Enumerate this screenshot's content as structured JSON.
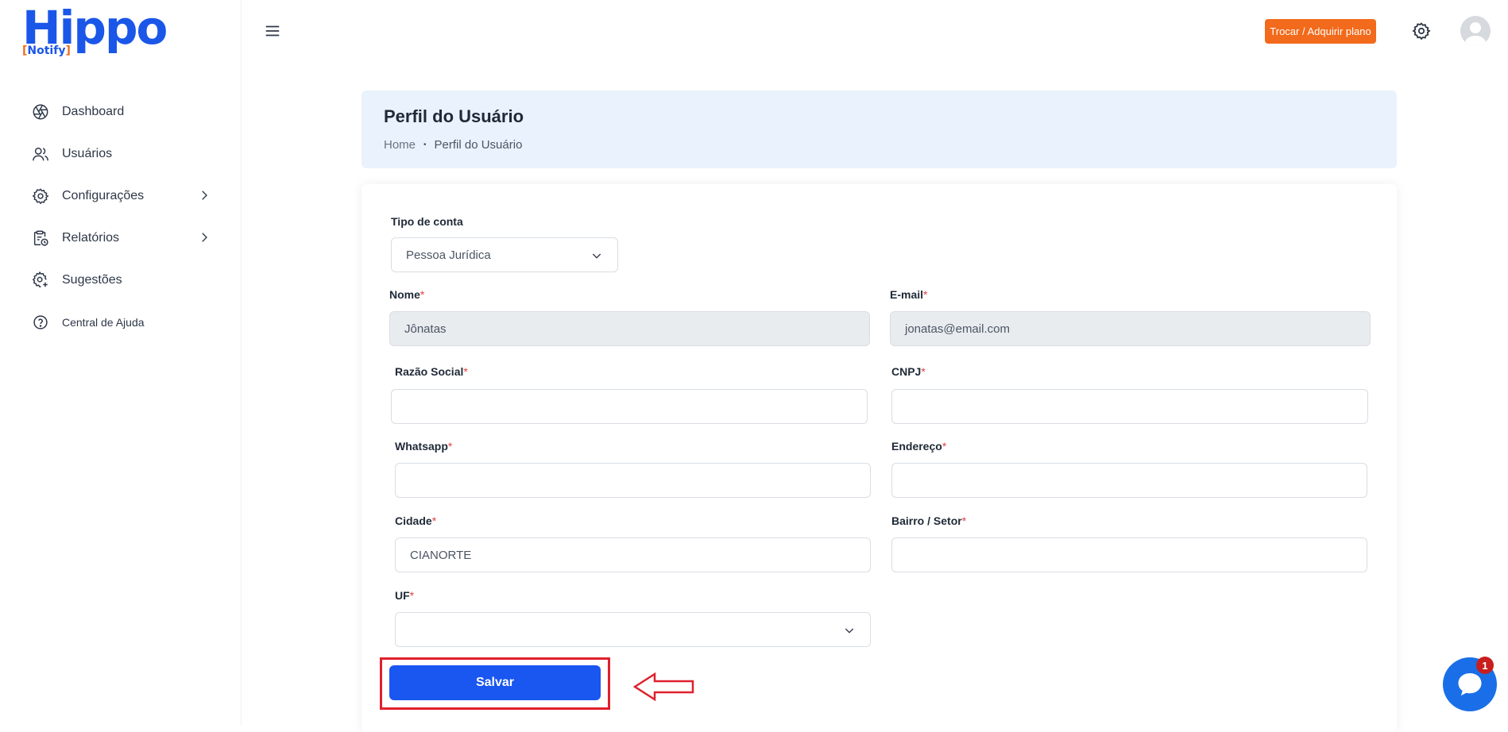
{
  "brand": {
    "name": "Hippo",
    "sub": "Notify",
    "sub_open": "[",
    "sub_close": "]"
  },
  "sidebar": {
    "items": [
      {
        "label": "Dashboard",
        "icon": "aperture-icon"
      },
      {
        "label": "Usuários",
        "icon": "users-icon"
      },
      {
        "label": "Configurações",
        "icon": "gear-icon",
        "has_children": true
      },
      {
        "label": "Relatórios",
        "icon": "clipboard-clock-icon",
        "has_children": true
      },
      {
        "label": "Sugestões",
        "icon": "gear-plus-icon"
      },
      {
        "label": "Central de Ajuda",
        "icon": "help-circle-icon"
      }
    ]
  },
  "topbar": {
    "plan_button": "Trocar / Adquirir plano"
  },
  "page": {
    "title": "Perfil do Usuário",
    "breadcrumb": {
      "home": "Home",
      "separator": "•",
      "current": "Perfil do Usuário"
    }
  },
  "form": {
    "account_type": {
      "label": "Tipo de conta",
      "value": "Pessoa Jurídica"
    },
    "nome": {
      "label": "Nome",
      "required": "*",
      "value": "Jônatas"
    },
    "email": {
      "label": "E-mail",
      "required": "*",
      "value": "jonatas@email.com"
    },
    "razao_social": {
      "label": "Razão Social",
      "required": "*",
      "value": ""
    },
    "cnpj": {
      "label": "CNPJ",
      "required": "*",
      "value": ""
    },
    "whatsapp": {
      "label": "Whatsapp",
      "required": "*",
      "value": ""
    },
    "endereco": {
      "label": "Endereço",
      "required": "*",
      "value": ""
    },
    "cidade": {
      "label": "Cidade",
      "required": "*",
      "value": "CIANORTE"
    },
    "bairro": {
      "label": "Bairro / Setor",
      "required": "*",
      "value": ""
    },
    "uf": {
      "label": "UF",
      "required": "*",
      "value": ""
    },
    "save_button": "Salvar"
  },
  "chat": {
    "badge": "1"
  },
  "colors": {
    "brand_blue": "#1a56e8",
    "accent_orange": "#f26a1b",
    "header_bg": "#eaf2fd",
    "highlight_red": "#e0202d"
  }
}
